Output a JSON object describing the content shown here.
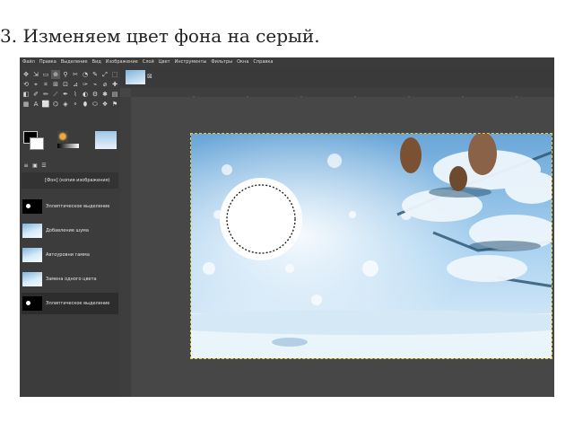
{
  "heading": "3. Изменяем цвет фона на серый.",
  "menu": [
    "Файл",
    "Правка",
    "Выделение",
    "Вид",
    "Изображение",
    "Слой",
    "Цвет",
    "Инструменты",
    "Фильтры",
    "Окна",
    "Справка"
  ],
  "tools": [
    "✥",
    "⇲",
    "▭",
    "⊕",
    "⚲",
    "✂",
    "◔",
    "✎",
    "⤢",
    "⬚",
    "⟲",
    "⌖",
    "⌗",
    "⊞",
    "⊡",
    "⊿",
    "✑",
    "⌁",
    "⌀",
    "✚",
    "◧",
    "✐",
    "✏",
    "⟋",
    "✒",
    "⌇",
    "◐",
    "⚙",
    "✱",
    "▤",
    "▦",
    "A",
    "⬜",
    "⌬",
    "◈",
    "⚬",
    "⬮",
    "⬭",
    "❖",
    "⚑"
  ],
  "layers_tabs": [
    "≡",
    "▣",
    "☰"
  ],
  "layers": [
    {
      "label": "[Фон] (копия изображения)",
      "thumb": "none"
    },
    {
      "label": "Эллиптическое выделение",
      "thumb": "black"
    },
    {
      "label": "Добавление шума",
      "thumb": "winter"
    },
    {
      "label": "Автоуровни гамма",
      "thumb": "winter"
    },
    {
      "label": "Замена одного цвета",
      "thumb": "winter"
    },
    {
      "label": "Эллиптическое выделение",
      "thumb": "black",
      "selected": true
    }
  ],
  "tab_close": "⊠",
  "colors": {
    "workspace": "#454545",
    "panel": "#3c3c3c",
    "selection": "#e0d040"
  }
}
